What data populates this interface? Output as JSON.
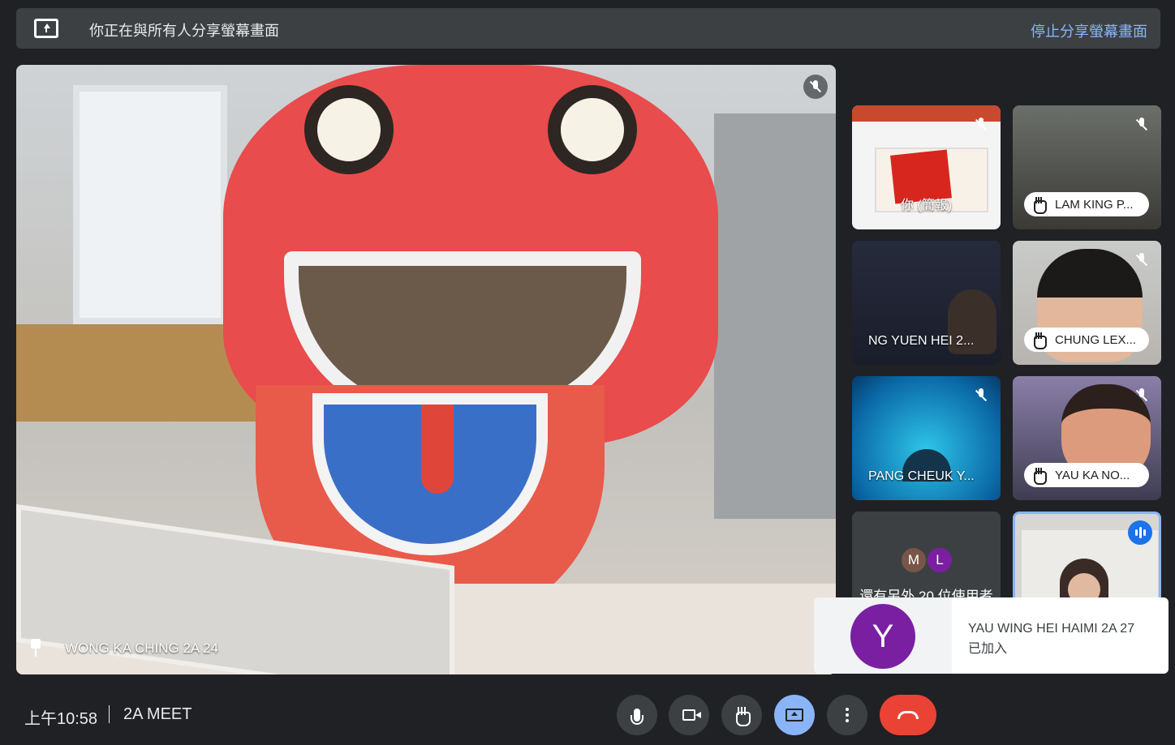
{
  "banner": {
    "text": "你正在與所有人分享螢幕畫面",
    "stop_label": "停止分享螢幕畫面"
  },
  "main_tile": {
    "name": "WONG KA CHING 2A 24",
    "muted": true,
    "pinned": true
  },
  "tiles": [
    {
      "name": "你 (簡報)",
      "muted": true,
      "hand_raised": false
    },
    {
      "name": "LAM KING P...",
      "muted": true,
      "hand_raised": true
    },
    {
      "name": "NG YUEN HEI 2...",
      "muted": false,
      "hand_raised": false
    },
    {
      "name": "CHUNG LEX...",
      "muted": true,
      "hand_raised": true
    },
    {
      "name": "PANG CHEUK Y...",
      "muted": true,
      "hand_raised": false
    },
    {
      "name": "YAU KA NO...",
      "muted": true,
      "hand_raised": true
    }
  ],
  "others_tile": {
    "avatars": [
      "M",
      "L"
    ],
    "text": "還有另外 20 位使用者"
  },
  "active_speaker": {
    "speaking": true
  },
  "toast": {
    "avatar_letter": "Y",
    "name": "YAU WING HEI HAIMI 2A 27",
    "status": "已加入"
  },
  "bottom_bar": {
    "time": "上午10:58",
    "meeting_name": "2A MEET"
  },
  "colors": {
    "background": "#202124",
    "accent": "#8ab4f8",
    "leave": "#ea4335",
    "speaking": "#1a73e8"
  },
  "icons": {
    "controls": [
      "microphone-icon",
      "camera-icon",
      "raise-hand-icon",
      "present-screen-icon",
      "more-options-icon",
      "hang-up-icon"
    ]
  }
}
